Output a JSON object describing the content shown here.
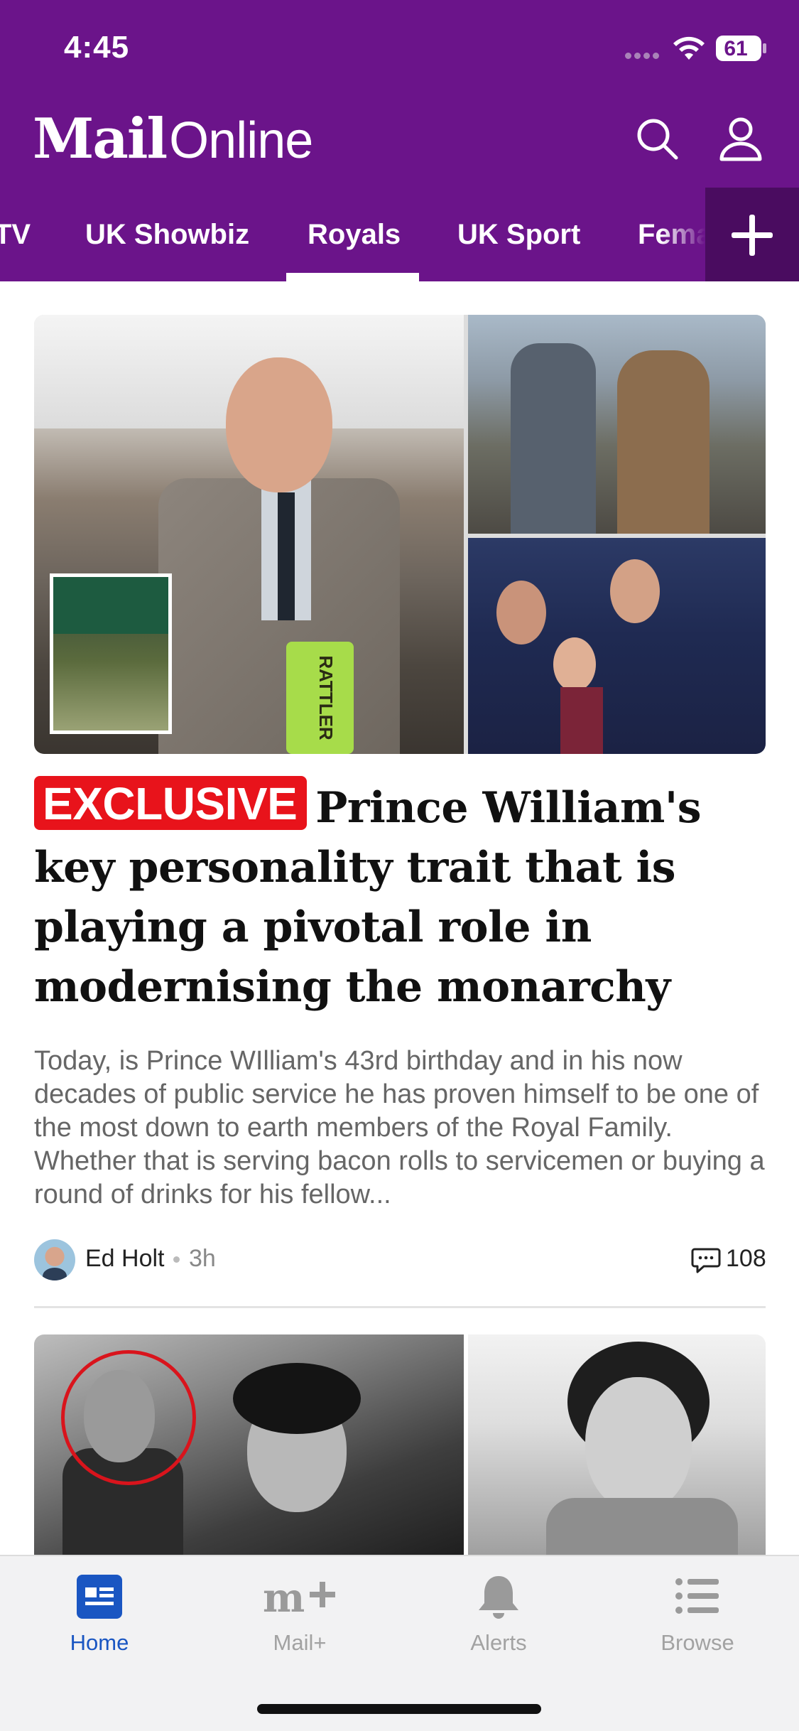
{
  "status_bar": {
    "time": "4:45",
    "battery": "61"
  },
  "header": {
    "logo_mail": "Mail",
    "logo_online": "Online"
  },
  "icons": {
    "search": "search-icon",
    "account": "user-icon",
    "add": "plus-icon",
    "comments": "comment-icon",
    "wifi": "wifi-icon"
  },
  "nav_tabs": {
    "items": [
      {
        "label": "TV"
      },
      {
        "label": "UK Showbiz"
      },
      {
        "label": "Royals",
        "active": true
      },
      {
        "label": "UK Sport"
      },
      {
        "label": "Femail"
      }
    ]
  },
  "article": {
    "badge": "EXCLUSIVE",
    "headline": "Prince William's key personality trait that is playing a pivotal role in modernising the monarchy",
    "summary": "Today, is Prince WIlliam's 43rd birthday and in his now decades of public service he has proven himself to be one of the most down to earth members of the Royal Family. Whether that is serving bacon rolls to servicemen or buying a round of drinks for his fellow...",
    "author": "Ed Holt",
    "time_ago": "3h",
    "comment_count": "108",
    "hero_cup_text": "RATTLER"
  },
  "bottom_nav": {
    "items": [
      {
        "label": "Home",
        "icon": "home-news-icon",
        "active": true
      },
      {
        "label": "Mail+",
        "icon": "mail-plus-icon"
      },
      {
        "label": "Alerts",
        "icon": "bell-icon"
      },
      {
        "label": "Browse",
        "icon": "list-icon"
      }
    ]
  },
  "colors": {
    "brand_purple": "#6b148a",
    "exclusive_red": "#e8131b",
    "active_blue": "#1a56c2"
  }
}
